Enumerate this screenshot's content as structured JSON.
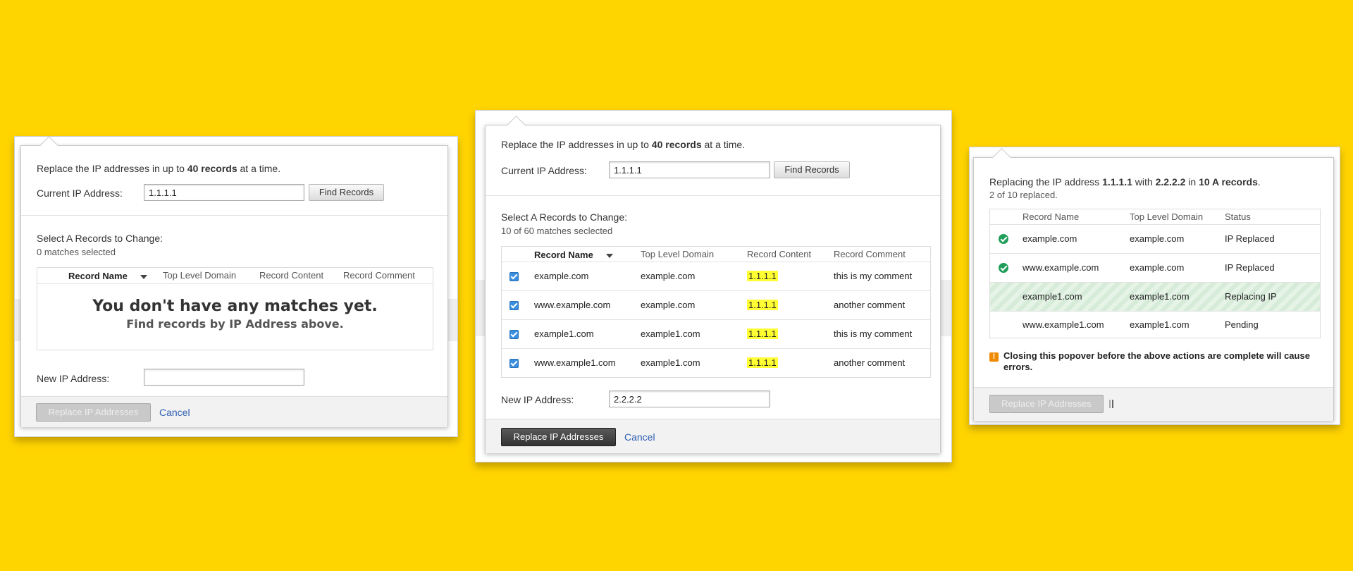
{
  "panel1": {
    "intro_pre": "Replace the IP addresses in up to",
    "intro_bold": "40 records",
    "intro_post": "at a time.",
    "current_ip_label": "Current IP Address:",
    "current_ip_value": "1.1.1.1",
    "find_button": "Find Records",
    "select_label": "Select A Records to Change:",
    "matches_count": "0 matches selected",
    "columns": [
      "Record Name",
      "Top Level Domain",
      "Record Content",
      "Record Comment"
    ],
    "empty_title": "You don't have any matches yet.",
    "empty_sub": "Find records by IP Address above.",
    "new_ip_label": "New IP Address:",
    "new_ip_value": "",
    "replace_button": "Replace IP Addresses",
    "cancel": "Cancel"
  },
  "panel2": {
    "intro_pre": "Replace the IP addresses in up to",
    "intro_bold": "40 records",
    "intro_post": "at a time.",
    "current_ip_label": "Current IP Address:",
    "current_ip_value": "1.1.1.1",
    "find_button": "Find Records",
    "select_label": "Select A Records to Change:",
    "matches_count": "10 of 60 matches seclected",
    "columns": [
      "Record Name",
      "Top Level Domain",
      "Record Content",
      "Record Comment"
    ],
    "rows": [
      {
        "name": "example.com",
        "tld": "example.com",
        "content": "1.1.1.1",
        "comment": "this is my comment",
        "checked": true
      },
      {
        "name": "www.example.com",
        "tld": "example.com",
        "content": "1.1.1.1",
        "comment": "another comment",
        "checked": true
      },
      {
        "name": "example1.com",
        "tld": "example1.com",
        "content": "1.1.1.1",
        "comment": "this is my comment",
        "checked": true
      },
      {
        "name": "www.example1.com",
        "tld": "example1.com",
        "content": "1.1.1.1",
        "comment": "another comment",
        "checked": true
      }
    ],
    "new_ip_label": "New IP Address:",
    "new_ip_value": "2.2.2.2",
    "replace_button": "Replace IP Addresses",
    "cancel": "Cancel"
  },
  "panel3": {
    "intro_pre": "Replacing the IP address",
    "old_ip": "1.1.1.1",
    "intro_with": "with",
    "new_ip": "2.2.2.2",
    "intro_in": "in",
    "records": "10 A records",
    "intro_end": ".",
    "progress_text": "2 of 10 replaced.",
    "columns": [
      "Record Name",
      "Top Level Domain",
      "Status"
    ],
    "rows": [
      {
        "name": "example.com",
        "tld": "example.com",
        "status": "IP Replaced",
        "icon": "check-icon"
      },
      {
        "name": "www.example.com",
        "tld": "example.com",
        "status": "IP Replaced",
        "icon": "check-icon"
      },
      {
        "name": "example1.com",
        "tld": "example1.com",
        "status": "Replacing IP",
        "icon": ""
      },
      {
        "name": "www.example1.com",
        "tld": "example1.com",
        "status": "Pending",
        "icon": ""
      }
    ],
    "warning_pre": "Closing this popover before the above actions are complete",
    "warning_bold": "will",
    "warning_post": "cause errors.",
    "replace_button": "Replace IP Addresses"
  },
  "colors": {
    "background": "#FFD500",
    "highlight": "#FFFF33",
    "success": "#1F9E5A",
    "warning": "#F08A00",
    "link": "#2F5FB3"
  }
}
